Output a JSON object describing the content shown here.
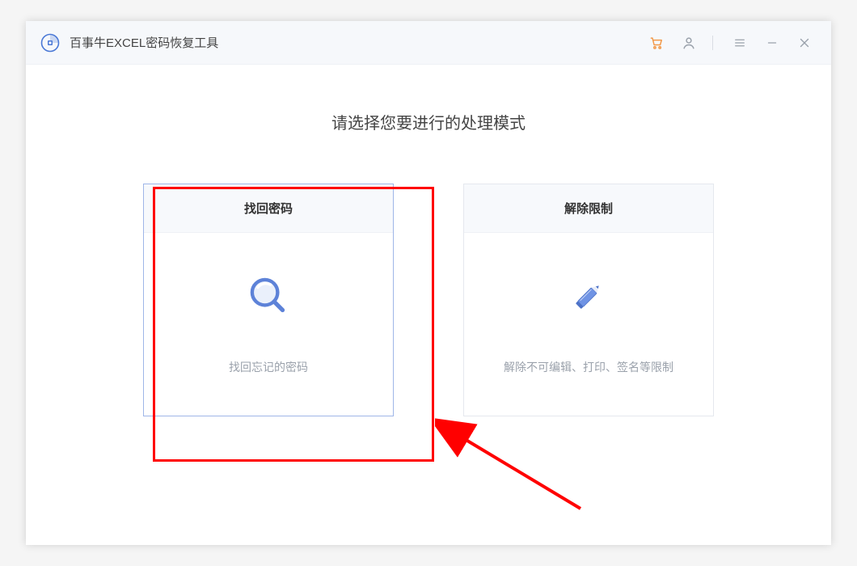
{
  "app": {
    "title": "百事牛EXCEL密码恢复工具"
  },
  "page": {
    "heading": "请选择您要进行的处理模式"
  },
  "cards": {
    "recover": {
      "title": "找回密码",
      "desc": "找回忘记的密码"
    },
    "unlock": {
      "title": "解除限制",
      "desc": "解除不可编辑、打印、签名等限制"
    }
  }
}
